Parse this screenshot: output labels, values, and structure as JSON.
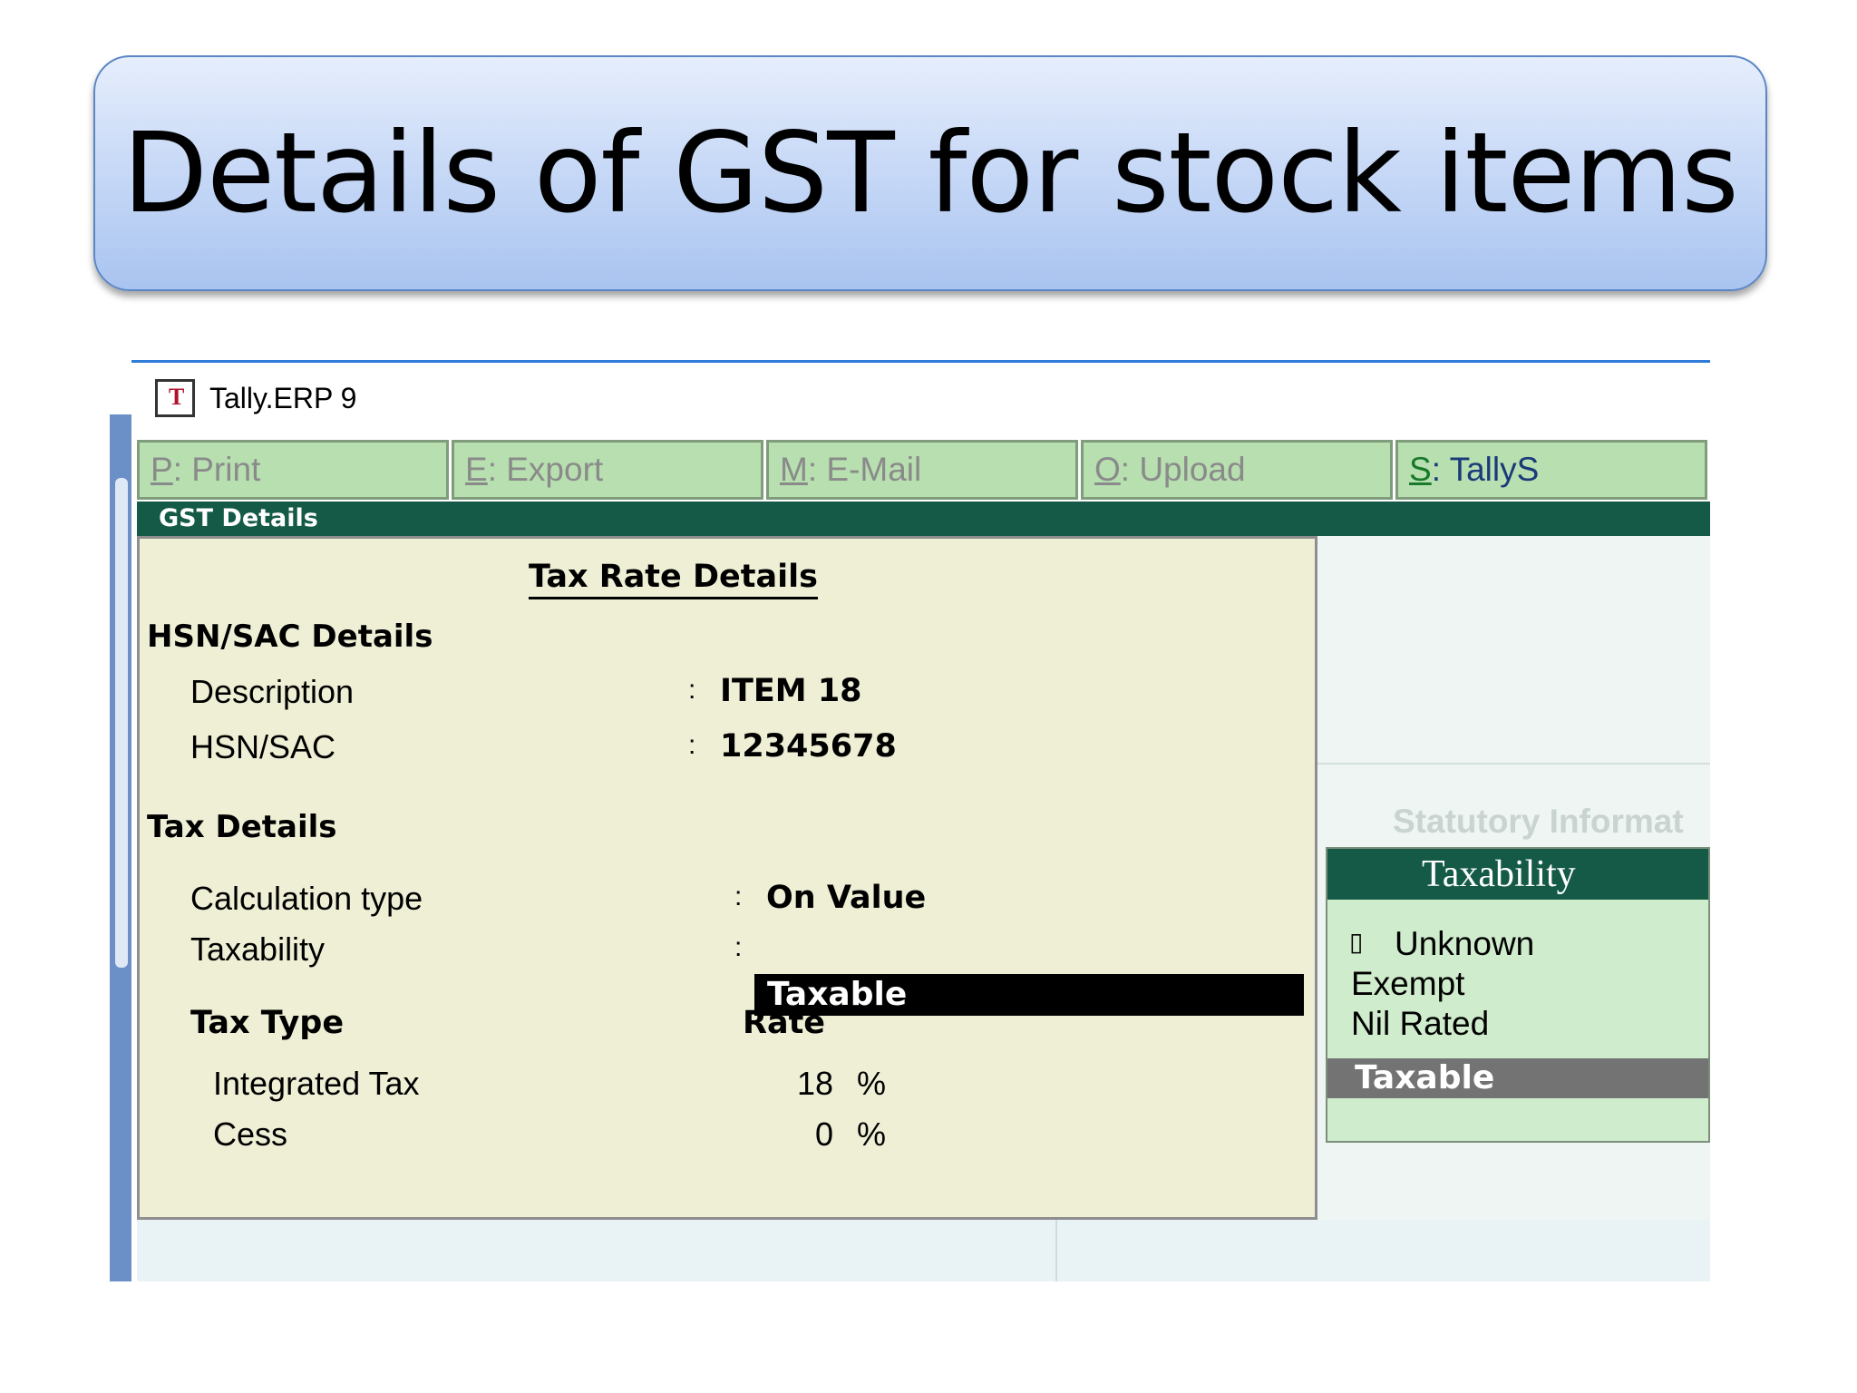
{
  "slide": {
    "title": "Details of GST for stock items"
  },
  "window": {
    "title": "Tally.ERP 9"
  },
  "toolbar": [
    {
      "key": "P",
      "label": ": Print"
    },
    {
      "key": "E",
      "label": ": Export"
    },
    {
      "key": "M",
      "label": ": E-Mail"
    },
    {
      "key": "O",
      "label": ": Upload"
    },
    {
      "key": "S",
      "label": ": TallyS"
    }
  ],
  "screen": {
    "header": "GST Details"
  },
  "form": {
    "heading": "Tax Rate Details",
    "hsn_section": "HSN/SAC Details",
    "description_label": "Description",
    "description_value": "ITEM 18",
    "hsn_label": "HSN/SAC",
    "hsn_value": "12345678",
    "tax_section": "Tax Details",
    "calc_type_label": "Calculation type",
    "calc_type_value": "On Value",
    "taxability_label": "Taxability",
    "taxability_value": "Taxable",
    "colon": ":",
    "tax_type_header": "Tax Type",
    "rate_header": "Rate",
    "rows": [
      {
        "type": "Integrated Tax",
        "rate": "18",
        "unit": "%"
      },
      {
        "type": "Cess",
        "rate": "0",
        "unit": "%"
      }
    ]
  },
  "background": {
    "statutory_label": "Statutory Informat"
  },
  "taxability_popup": {
    "title": "Taxability",
    "marker": "▯",
    "options": [
      "Unknown",
      "Exempt",
      "Nil Rated",
      "Taxable"
    ],
    "selected": "Taxable"
  }
}
